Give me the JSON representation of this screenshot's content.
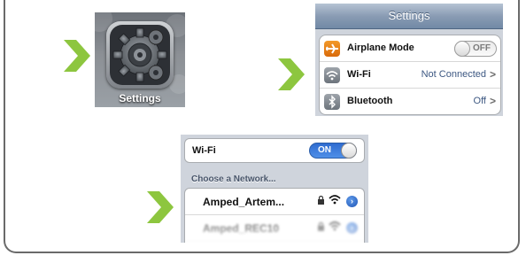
{
  "colors": {
    "arrow": "#8dc63f",
    "toggle_on": "#2f6cd0",
    "value_text": "#3d5882"
  },
  "arrows": [
    "arrow-icon",
    "arrow-icon",
    "arrow-icon"
  ],
  "home_screen": {
    "app_label": "Settings",
    "icon": "gear-icon"
  },
  "settings_panel": {
    "title": "Settings",
    "rows": [
      {
        "label": "Airplane Mode",
        "icon": "airplane-icon",
        "toggle_label": "OFF"
      },
      {
        "label": "Wi-Fi",
        "icon": "wifi-icon",
        "value": "Not Connected"
      },
      {
        "label": "Bluetooth",
        "icon": "bluetooth-icon",
        "value": "Off"
      }
    ]
  },
  "wifi_panel": {
    "wifi_label": "Wi-Fi",
    "toggle_label": "ON",
    "section_header": "Choose a Network...",
    "networks": [
      {
        "name": "Amped_Artem...",
        "secured": true
      },
      {
        "name": "Amped_REC10",
        "secured": true
      }
    ]
  }
}
